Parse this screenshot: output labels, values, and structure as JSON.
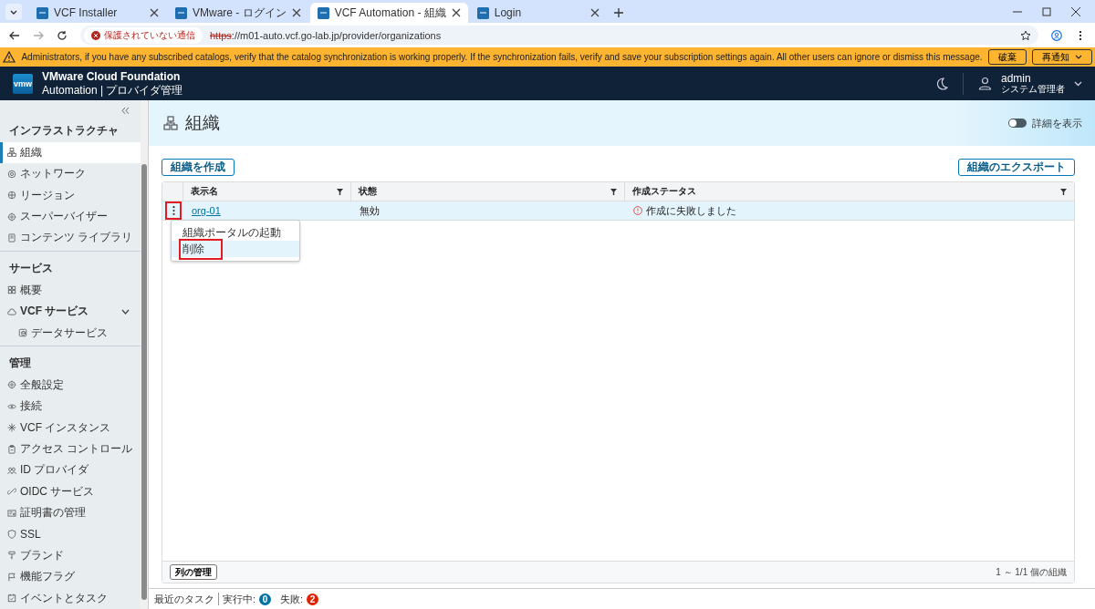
{
  "browser": {
    "tabs": [
      {
        "title": "VCF Installer",
        "selected": false
      },
      {
        "title": "VMware - ログイン",
        "selected": false
      },
      {
        "title": "VCF Automation - 組織",
        "selected": true
      },
      {
        "title": "Login",
        "selected": false
      }
    ],
    "security_label": "保護されていない通信",
    "url_scheme": "https",
    "url_rest": "://m01-auto.vcf.go-lab.jp/provider/organizations"
  },
  "banner": {
    "message": "Administrators, if you have any subscribed catalogs, verify that the catalog synchronization is working properly. If the synchronization fails, verify and save your subscription settings again. All other users can ignore or dismiss this message.",
    "buttons": [
      "破棄",
      "再通知"
    ]
  },
  "header": {
    "product": "VMware Cloud Foundation",
    "subtitle": "Automation | プロバイダ管理",
    "logo": "vmw",
    "user": "admin",
    "role": "システム管理者"
  },
  "sidebar": {
    "sections": [
      {
        "title": "インフラストラクチャ",
        "items": [
          {
            "label": "組織",
            "selected": true
          },
          {
            "label": "ネットワーク",
            "selected": false
          },
          {
            "label": "リージョン",
            "selected": false
          },
          {
            "label": "スーパーバイザー",
            "selected": false
          },
          {
            "label": "コンテンツ ライブラリ",
            "selected": false
          }
        ]
      },
      {
        "title": "サービス",
        "items": [
          {
            "label": "概要",
            "selected": false
          },
          {
            "label": "VCF サービス",
            "selected": false,
            "expanded": true,
            "children": [
              {
                "label": "データサービス",
                "selected": false
              }
            ]
          }
        ]
      },
      {
        "title": "管理",
        "items": [
          {
            "label": "全般設定",
            "selected": false
          },
          {
            "label": "接続",
            "selected": false
          },
          {
            "label": "VCF インスタンス",
            "selected": false
          },
          {
            "label": "アクセス コントロール",
            "selected": false
          },
          {
            "label": "ID プロバイダ",
            "selected": false
          },
          {
            "label": "OIDC サービス",
            "selected": false
          },
          {
            "label": "証明書の管理",
            "selected": false
          },
          {
            "label": "SSL",
            "selected": false
          },
          {
            "label": "ブランド",
            "selected": false
          },
          {
            "label": "機能フラグ",
            "selected": false
          },
          {
            "label": "イベントとタスク",
            "selected": false
          }
        ]
      }
    ]
  },
  "page": {
    "title": "組織",
    "details_toggle": {
      "label": "詳細を表示",
      "on": false
    },
    "create_button": "組織を作成",
    "export_button": "組織のエクスポート"
  },
  "table": {
    "columns": [
      "表示名",
      "状態",
      "作成ステータス"
    ],
    "rows": [
      {
        "name": "org-01",
        "state": "無効",
        "status": "作成に失敗しました",
        "selected": true,
        "actions_highlighted": true
      }
    ],
    "row_menu": {
      "items": [
        {
          "label": "組織ポータルの起動",
          "hovered": false,
          "highlighted": false
        },
        {
          "label": "削除",
          "hovered": true,
          "highlighted": true
        }
      ]
    },
    "manage_columns": "列の管理",
    "footer_count": "1 ～ 1/1 個の組織"
  },
  "tasks": {
    "title": "最近のタスク",
    "running_label": "実行中:",
    "running_count": "0",
    "failed_label": "失敗:",
    "failed_count": "2"
  }
}
